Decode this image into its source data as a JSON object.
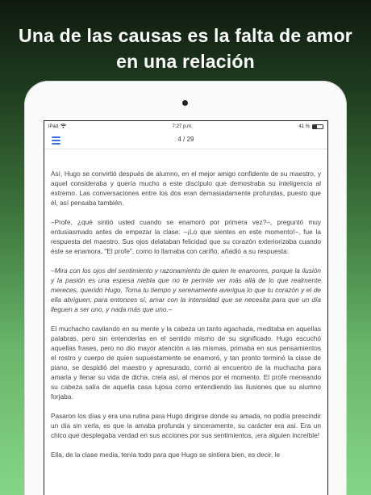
{
  "headline": {
    "line1": "Una de las causas es la falta de amor",
    "line2": "en una relación"
  },
  "status_bar": {
    "device": "iPad",
    "wifi_icon": "wifi-icon",
    "time": "7:27 p.m.",
    "battery_percent": "41 %",
    "battery_level": 0.41
  },
  "toolbar": {
    "menu_icon": "hamburger-menu-icon",
    "accent_color": "#3a6fd8",
    "page_indicator": "4 / 29"
  },
  "book": {
    "paragraphs": [
      "Así, Hugo se convirtió después de alumno, en el mejor amigo confidente de su maestro, y aquel consideraba y quería mucho a este discípulo que demostraba su inteligencia al extremo. Las conversaciones entre los dos eran demasiadamente profundas, puesto que él, así pensaba también.",
      "–Profe, ¿qué sintió usted cuando se enamoró por primera vez?–, preguntó muy entusiasmado antes de empezar la clase. –¡Lo que sientes en este momento!–, fue la respuesta del maestro. Sus ojos delataban felicidad que su corazón exteriorizaba cuando éste se enamora. \"El profe\", como lo llamaba con cariño, añadió a su respuesta:",
      "–Mira con los ojos del sentimiento y razonamiento de quien te enamores, porque la ilusión y la pasión es una espesa niebla que no te permite ver más allá de lo que realmente mereces, querido Hugo. Toma tu tiempo y serenamente averigua lo que tu corazón y el de ella abriguen, para entonces sí, amar con la intensidad que se necesita para que un día lleguen a ser uno, y nada más que uno.–",
      "El muchacho cavilando en su mente y la cabeza un tanto agachada, meditaba en aquellas palabras, pero sin entenderlas en el sentido mismo de su significado. Hugo escuchó aquellas frases, pero no dio mayor atención a las mismas, primaba en sus pensamientos el rostro y cuerpo de quien supuestamente se enamoró, y tan pronto terminó la clase de piano, se despidió del maestro y apresurado, corrió al encuentro de la muchacha para amarla y llenar su vida de dicha, creía así, al menos por el momento. El profe meneando su cabeza salía de aquella casa lujosa como entendiendo las ilusiones que su alumno forjaba.",
      "Pasaron los días y era una rutina para Hugo dirigirse donde su amada, no podía prescindir un día sin verla, es que la amaba profunda y sinceramente, su carácter era así. Era un chico que desplegaba verdad en sus acciones por sus sentimientos, ¡era alguien increíble!",
      "Ella, de la clase media, tenía todo para que Hugo se sintiera bien, es decir, le"
    ]
  }
}
